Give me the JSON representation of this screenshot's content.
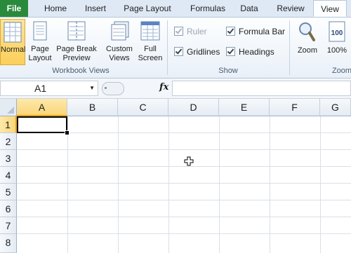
{
  "tabs": [
    "File",
    "Home",
    "Insert",
    "Page Layout",
    "Formulas",
    "Data",
    "Review",
    "View"
  ],
  "active_tab": "View",
  "workbook_views": {
    "group_label": "Workbook Views",
    "buttons": [
      {
        "label_line1": "Normal",
        "label_line2": ""
      },
      {
        "label_line1": "Page",
        "label_line2": "Layout"
      },
      {
        "label_line1": "Page Break",
        "label_line2": "Preview"
      },
      {
        "label_line1": "Custom",
        "label_line2": "Views"
      },
      {
        "label_line1": "Full",
        "label_line2": "Screen"
      }
    ]
  },
  "show": {
    "group_label": "Show",
    "checkboxes": [
      {
        "label": "Ruler",
        "checked": true,
        "disabled": true
      },
      {
        "label": "Formula Bar",
        "checked": true,
        "disabled": false
      },
      {
        "label": "Gridlines",
        "checked": true,
        "disabled": false
      },
      {
        "label": "Headings",
        "checked": true,
        "disabled": false
      }
    ]
  },
  "zoom": {
    "group_label": "Zoom",
    "buttons": [
      {
        "label": "Zoom"
      },
      {
        "label": "100%"
      }
    ]
  },
  "formula_bar": {
    "name_box": "A1",
    "fx": "fx",
    "formula": ""
  },
  "sheet": {
    "columns": [
      "A",
      "B",
      "C",
      "D",
      "E",
      "F",
      "G"
    ],
    "rows": [
      "1",
      "2",
      "3",
      "4",
      "5",
      "6",
      "7",
      "8"
    ],
    "active_cell": "A1"
  },
  "colors": {
    "file_tab": "#2a8a3c",
    "selected_header": "#f9d67a",
    "ribbon_bg": "#e9f0f8"
  }
}
